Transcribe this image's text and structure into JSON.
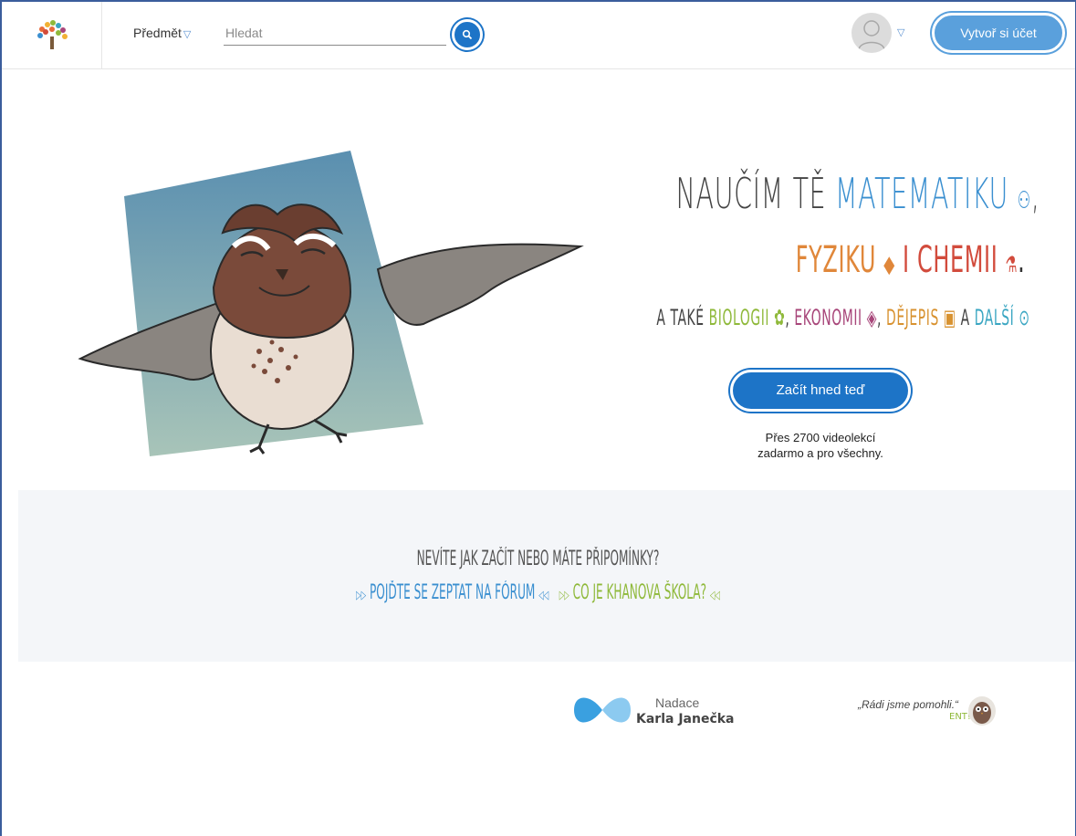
{
  "header": {
    "subject_label": "Předmět",
    "search_placeholder": "Hledat",
    "signup_label": "Vytvoř si účet"
  },
  "hero": {
    "line1_a": "NAUČÍM TĚ ",
    "line1_b": "MATEMATIKU",
    "line1_end": ",",
    "line2_a": "FYZIKU",
    "line2_b": " I ",
    "line2_c": "CHEMII",
    "line2_end": ".",
    "line3_a": "A TAKÉ ",
    "line3_biology": "BIOLOGII",
    "line3_sep1": ", ",
    "line3_econ": "EKONOMII",
    "line3_sep2": ", ",
    "line3_history": "DĚJEPIS",
    "line3_and": " A ",
    "line3_more": "DALŠÍ",
    "start_label": "Začít hned teď",
    "start_sub_1": "Přes 2700 videolekcí",
    "start_sub_2": "zadarmo a pro všechny."
  },
  "band": {
    "question": "NEVÍTE JAK ZAČÍT NEBO MÁTE PŘIPOMÍNKY?",
    "link_forum": "POJĎTE SE ZEPTAT NA FÓRUM",
    "link_about": "CO JE KHANOVA ŠKOLA?"
  },
  "footer": {
    "nadace_1": "Nadace",
    "nadace_2": "Karla Janečka",
    "thanks": "„Rádi jsme pomohli.“",
    "ent": "ENT!"
  },
  "colors": {
    "primary": "#1d74c7",
    "light_blue": "#5aa0dc",
    "band_bg": "#f4f6f9"
  }
}
